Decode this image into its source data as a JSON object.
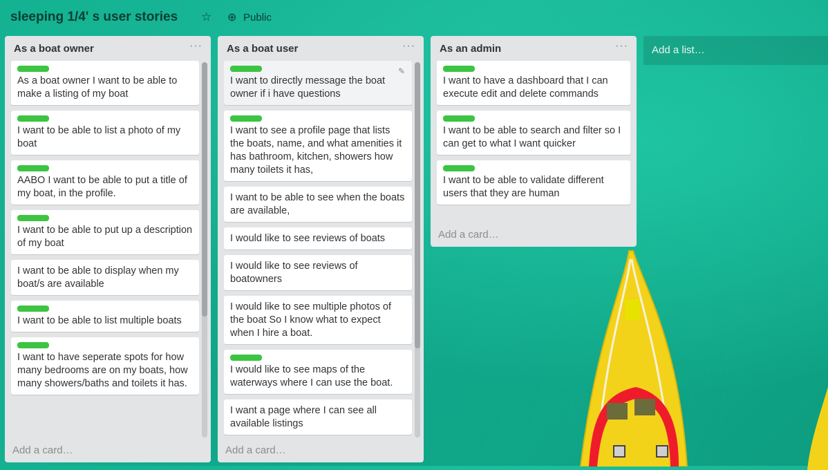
{
  "board": {
    "title": "sleeping 1/4' s user stories",
    "visibility": "Public",
    "icons": {
      "star": "star-icon",
      "visibility": "globe-icon"
    }
  },
  "lists": [
    {
      "title": "As a boat owner",
      "add_card": "Add a card…",
      "cards": [
        {
          "label": true,
          "text": "As a boat owner I want to be able to make a listing of my boat"
        },
        {
          "label": true,
          "text": "I want to be able to list a photo of my boat"
        },
        {
          "label": true,
          "text": "AABO I want to be able to put a title of my boat, in the profile."
        },
        {
          "label": true,
          "text": "I want to be able to put up a description of my boat"
        },
        {
          "label": false,
          "text": "I want to be able to display when my boat/s are available"
        },
        {
          "label": true,
          "text": "I want to be able to list multiple boats"
        },
        {
          "label": true,
          "text": "I want to have seperate spots for how many bedrooms are on my boats, how many showers/baths and toilets it has."
        }
      ]
    },
    {
      "title": "As a boat user",
      "add_card": "Add a card…",
      "cards": [
        {
          "label": true,
          "text": "I want to directly message the boat owner if i have questions",
          "hover": true
        },
        {
          "label": true,
          "text": "I want to see a profile page that lists the boats, name, and what amenities it has bathroom, kitchen, showers how many toilets it has,"
        },
        {
          "label": false,
          "text": "I want to be able to see when the boats are available,"
        },
        {
          "label": false,
          "text": "I would like to see reviews of boats"
        },
        {
          "label": false,
          "text": "I would like to see reviews of boatowners"
        },
        {
          "label": false,
          "text": "I would like to see multiple photos of the boat So I know what to expect when I hire a boat."
        },
        {
          "label": true,
          "text": "I would like to see maps of the waterways where I can use the boat."
        },
        {
          "label": false,
          "text": "I want a page where I can see all available listings"
        }
      ]
    },
    {
      "title": "As an admin",
      "add_card": "Add a card…",
      "cards": [
        {
          "label": true,
          "text": "I want to have a dashboard that I can execute edit and delete commands"
        },
        {
          "label": true,
          "text": "I want to be able to search and filter so I can get to what I want quicker"
        },
        {
          "label": true,
          "text": "I want to be able to validate different users that they are human"
        }
      ]
    }
  ],
  "add_list": "Add a list…",
  "colors": {
    "label_green": "#3cc442",
    "list_bg": "#e2e4e6",
    "board_bg": "#13b291"
  }
}
